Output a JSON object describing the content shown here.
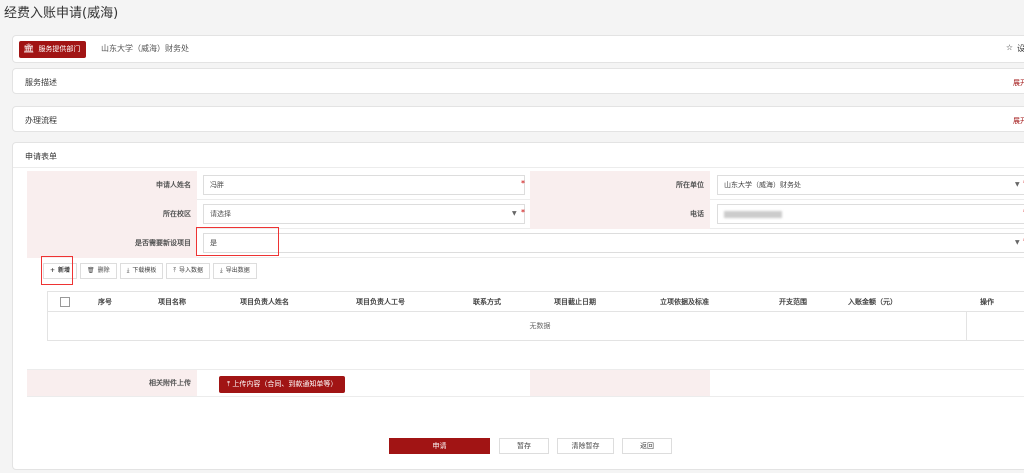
{
  "page": {
    "title": "经费入账申请(威海)"
  },
  "provider": {
    "tag_label": "服务提供部门",
    "name": "山东大学（威海）财务处",
    "setting_label": "设"
  },
  "sections": {
    "description": {
      "title": "服务描述",
      "expand": "展开"
    },
    "process": {
      "title": "办理流程",
      "expand": "展开"
    }
  },
  "form": {
    "title": "申请表单",
    "applicant_name": {
      "label": "申请人姓名",
      "value": "冯胖"
    },
    "unit": {
      "label": "所在单位",
      "value": "山东大学（威海）财务处"
    },
    "campus": {
      "label": "所在校区",
      "placeholder": "请选择"
    },
    "phone": {
      "label": "电话"
    },
    "new_project": {
      "label": "是否需要新设项目",
      "value": "是"
    },
    "toolbar": {
      "add": "新增",
      "delete": "删除",
      "download_template": "下载模板",
      "import": "导入数据",
      "export": "导出数据"
    },
    "table": {
      "columns": [
        "序号",
        "项目名称",
        "项目负责人姓名",
        "项目负责人工号",
        "联系方式",
        "项目截止日期",
        "立项依据及标准",
        "开支范围",
        "入账金额（元）",
        "操作"
      ],
      "empty_text": "无数据"
    },
    "attachment": {
      "label": "相关附件上传",
      "button": "上传内容（合同、到款通知单等）"
    }
  },
  "actions": {
    "submit": "申请",
    "save_draft": "暂存",
    "clear_draft": "清除暂存",
    "back": "返回"
  },
  "colors": {
    "accent": "#a11414",
    "label_bg": "#f9eeee"
  }
}
